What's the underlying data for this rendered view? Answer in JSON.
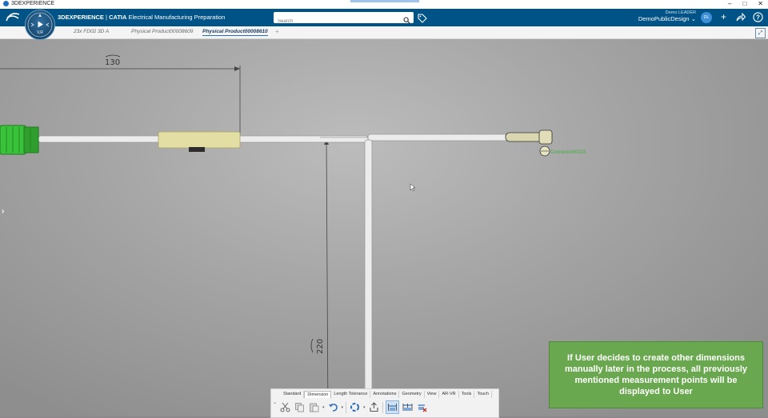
{
  "window": {
    "title": "3DEXPERIENCE",
    "controls": [
      "–",
      "□",
      "✕"
    ]
  },
  "header": {
    "brand_bold": "3DEXPERIENCE",
    "brand_sep": " | ",
    "brand_product": "CATIA",
    "app_name": "Electrical Manufacturing Preparation",
    "search_placeholder": "Search",
    "user_name": "Demo LEADER",
    "workspace": "DemoPublicDesign",
    "avatar_initials": "DL",
    "compass_version": "V,R"
  },
  "tabs": [
    {
      "label": "23x FD02 3D A",
      "active": false
    },
    {
      "label": "Physical Product00008609",
      "active": false
    },
    {
      "label": "Physical Product00008610",
      "active": true
    }
  ],
  "tab_add": "+",
  "viewport": {
    "dim_horizontal": "130",
    "dim_vertical": "220",
    "connector_label": "Connector00023"
  },
  "toolbar": {
    "tabs": [
      "Standard",
      "Dimension",
      "Length Tolerance",
      "Annotations",
      "Geometry",
      "View",
      "AR-VR",
      "Tools",
      "Touch"
    ],
    "active_tab": "Dimension",
    "icons": [
      "cut-icon",
      "copy-icon",
      "paste-icon",
      "undo-icon",
      "update-icon",
      "export-icon",
      "dimension-icon",
      "dimension-chain-icon",
      "dimension-delete-icon"
    ]
  },
  "note": {
    "text": "If User decides to create other dimensions manually later in the process, all previously mentioned measurement points will be displayed to User",
    "color": "#6aa84f"
  },
  "colors": {
    "header": "#005386",
    "connector_green": "#39c23a",
    "clamp": "#e3dfa4"
  }
}
